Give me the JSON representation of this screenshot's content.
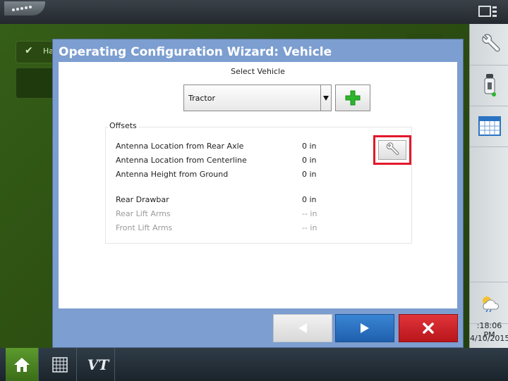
{
  "top_bar": {
    "logo_text": "",
    "right_icon": "display-layout-icon"
  },
  "background": {
    "panel_text": "Ha",
    "sidebar": {
      "icons": [
        "wrench-icon",
        "gps-receiver-icon",
        "calendar-grid-icon",
        "weather-icon"
      ],
      "time": ":18:06 PM",
      "date": "4/10/2015"
    }
  },
  "bottom_bar": {
    "home_icon": "home-icon",
    "grid_icon": "grid-icon",
    "vt_label": "VT"
  },
  "dialog": {
    "title": "Operating Configuration Wizard:  Vehicle",
    "select_label": "Select Vehicle",
    "vehicle_value": "Tractor",
    "offsets_title": "Offsets",
    "rows": [
      {
        "label": "Antenna Location from Rear Axle",
        "value": "0 in",
        "enabled": true
      },
      {
        "label": "Antenna Location from Centerline",
        "value": "0 in",
        "enabled": true
      },
      {
        "label": "Antenna Height from Ground",
        "value": "0 in",
        "enabled": true
      },
      {
        "label": "Rear Drawbar",
        "value": "0 in",
        "enabled": true
      },
      {
        "label": "Rear Lift Arms",
        "value": "-- in",
        "enabled": false
      },
      {
        "label": "Front Lift Arms",
        "value": "-- in",
        "enabled": false
      }
    ]
  },
  "colors": {
    "dialog_frame": "#7c9ed0",
    "next_blue": "#2a73c2",
    "cancel_red": "#cc2228",
    "highlight_red": "#e3182b",
    "add_green": "#2db52d"
  }
}
